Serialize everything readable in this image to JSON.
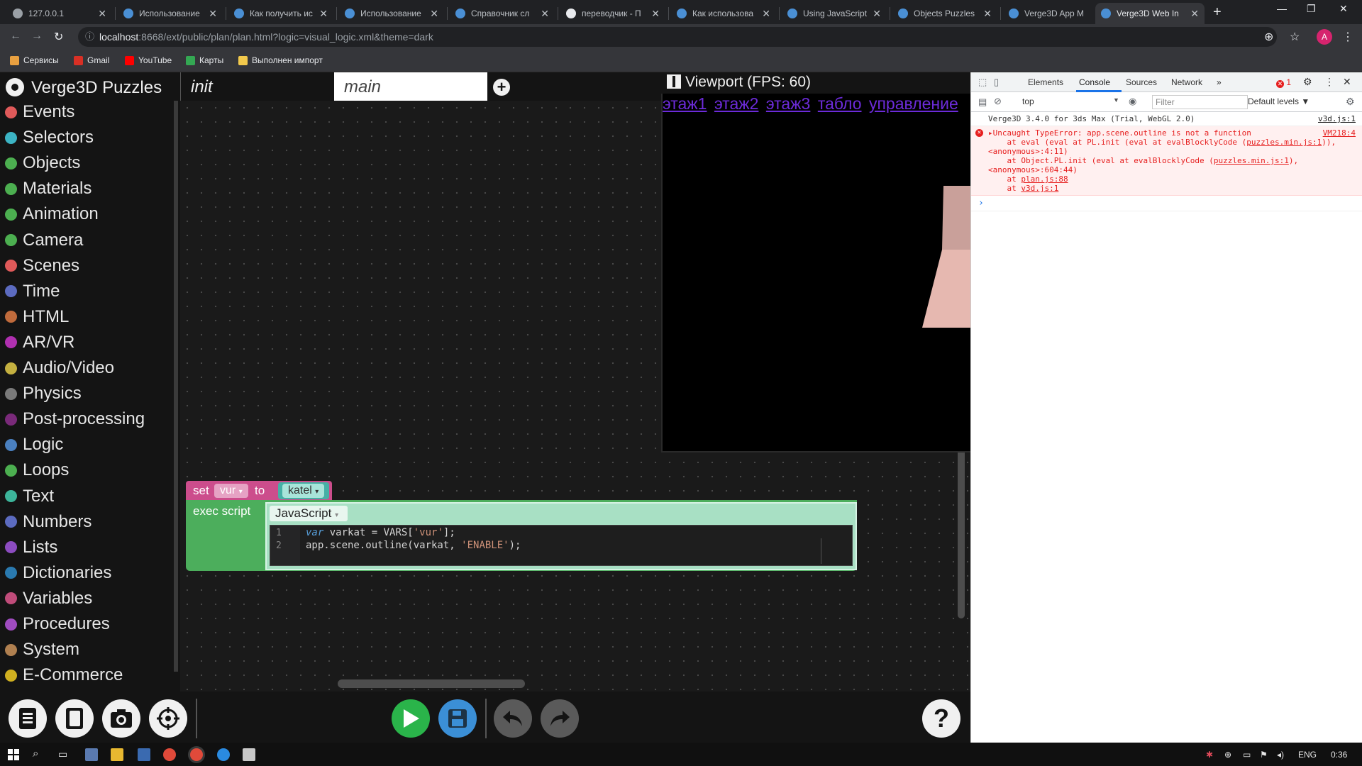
{
  "browser": {
    "tabs": [
      {
        "title": "127.0.0.1"
      },
      {
        "title": "Использование"
      },
      {
        "title": "Как получить ис"
      },
      {
        "title": "Использование"
      },
      {
        "title": "Справочник сл"
      },
      {
        "title": "переводчик - П"
      },
      {
        "title": "Как использова"
      },
      {
        "title": "Using JavaScript"
      },
      {
        "title": "Objects Puzzles"
      },
      {
        "title": "Verge3D App M"
      },
      {
        "title": "Verge3D Web In"
      }
    ],
    "active_tab_index": 10,
    "url_host": "localhost",
    "url_path": ":8668/ext/public/plan/plan.html?logic=visual_logic.xml&theme=dark",
    "profile_initial": "A",
    "bookmarks": [
      {
        "label": "Сервисы"
      },
      {
        "label": "Gmail"
      },
      {
        "label": "YouTube"
      },
      {
        "label": "Карты"
      },
      {
        "label": "Выполнен импорт"
      }
    ]
  },
  "puzzles": {
    "title": "Verge3D Puzzles",
    "tab_init": "init",
    "tab_main": "main",
    "categories": [
      {
        "label": "Events",
        "color": "#e05a5a"
      },
      {
        "label": "Selectors",
        "color": "#3cb4c4"
      },
      {
        "label": "Objects",
        "color": "#4caf50"
      },
      {
        "label": "Materials",
        "color": "#4caf50"
      },
      {
        "label": "Animation",
        "color": "#4caf50"
      },
      {
        "label": "Camera",
        "color": "#4caf50"
      },
      {
        "label": "Scenes",
        "color": "#e05a5a"
      },
      {
        "label": "Time",
        "color": "#5c6bc0"
      },
      {
        "label": "HTML",
        "color": "#c06b3c"
      },
      {
        "label": "AR/VR",
        "color": "#b030b0"
      },
      {
        "label": "Audio/Video",
        "color": "#c4b040"
      },
      {
        "label": "Physics",
        "color": "#7a7a7a"
      },
      {
        "label": "Post-processing",
        "color": "#7a2a7a"
      },
      {
        "label": "Logic",
        "color": "#4a80c0"
      },
      {
        "label": "Loops",
        "color": "#4caf50"
      },
      {
        "label": "Text",
        "color": "#3cb49a"
      },
      {
        "label": "Numbers",
        "color": "#5c6bc0"
      },
      {
        "label": "Lists",
        "color": "#8c4cc0"
      },
      {
        "label": "Dictionaries",
        "color": "#2a7ab0"
      },
      {
        "label": "Variables",
        "color": "#c04c7a"
      },
      {
        "label": "Procedures",
        "color": "#a04cc0"
      },
      {
        "label": "System",
        "color": "#b08050"
      },
      {
        "label": "E-Commerce",
        "color": "#d0b020"
      }
    ],
    "blocks": {
      "set_label": "set",
      "var_name": "vur",
      "to_label": "to",
      "value": "katel",
      "exec_label": "exec script",
      "lang": "JavaScript",
      "code": [
        {
          "num": "1",
          "kw": "var",
          "rest": " varkat = VARS[",
          "str": "'vur'",
          "tail": "];"
        },
        {
          "num": "2",
          "pre": "app.scene.outline(varkat, ",
          "str": "'ENABLE'",
          "tail": ");"
        }
      ]
    }
  },
  "viewport": {
    "title": "Viewport (FPS: 60)",
    "links": [
      "этаж1",
      "этаж2",
      "этаж3",
      "табло",
      "управление"
    ]
  },
  "devtools": {
    "tabs": [
      "Elements",
      "Console",
      "Sources",
      "Network"
    ],
    "more": "»",
    "error_count": "1",
    "context": "top",
    "filter_placeholder": "Filter",
    "levels": "Default levels ▼",
    "messages": {
      "info": {
        "text": "Verge3D 3.4.0 for 3ds Max (Trial, WebGL 2.0)",
        "src": "v3d.js:1"
      },
      "error": {
        "src": "VM218:4",
        "head": "Uncaught TypeError: app.scene.outline is not a function",
        "lines": [
          "    at eval (eval at PL.init (eval at evalBlocklyCode (",
          "puzzles.min.js:1",
          ")),",
          "<anonymous>:4:11)",
          "    at Object.PL.init (eval at evalBlocklyCode (",
          "puzzles.min.js:1",
          "),",
          "<anonymous>:604:44)",
          "    at ",
          "plan.js:88",
          "    at ",
          "v3d.js:1"
        ]
      }
    }
  },
  "taskbar": {
    "lang": "ENG",
    "time": "0:36"
  }
}
